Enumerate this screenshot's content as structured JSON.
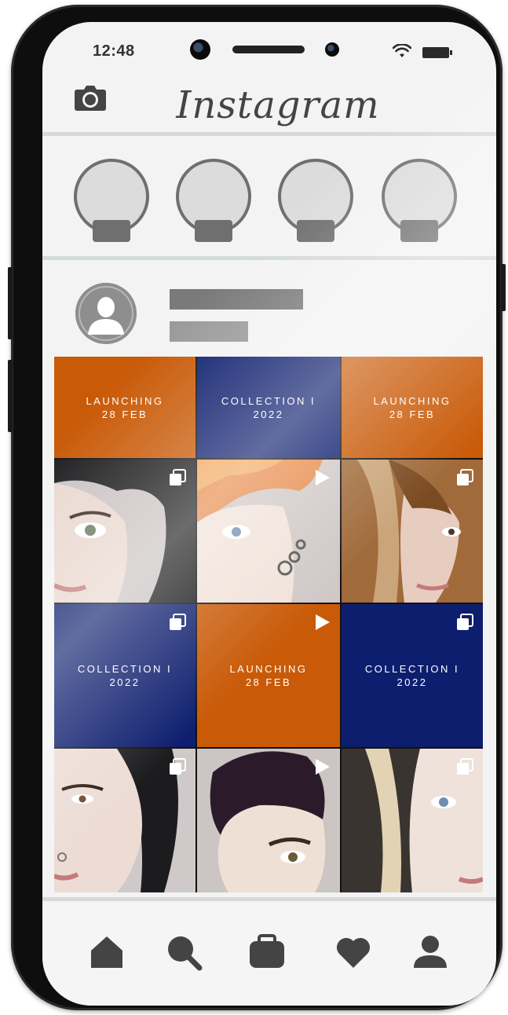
{
  "status_bar": {
    "time": "12:48"
  },
  "header": {
    "logo_text": "Instagram",
    "camera_icon": "camera-icon"
  },
  "stories": [
    {
      "icon": "story-avatar"
    },
    {
      "icon": "story-avatar"
    },
    {
      "icon": "story-avatar"
    },
    {
      "icon": "story-avatar"
    }
  ],
  "profile": {
    "avatar_icon": "user-silhouette-icon"
  },
  "grid": {
    "rows": [
      [
        {
          "kind": "text",
          "color": "#c95a08",
          "line1": "LAUNCHING",
          "line2": "28 FEB"
        },
        {
          "kind": "text",
          "color": "#0e1e6e",
          "line1": "COLLECTION I",
          "line2": "2022"
        },
        {
          "kind": "text",
          "color": "#c95a08",
          "line1": "LAUNCHING",
          "line2": "28 FEB"
        }
      ],
      [
        {
          "kind": "photo",
          "overlay": "carousel-icon"
        },
        {
          "kind": "photo",
          "overlay": "play-icon"
        },
        {
          "kind": "photo",
          "overlay": "carousel-icon"
        }
      ],
      [
        {
          "kind": "text",
          "color": "#0e1e6e",
          "line1": "COLLECTION I",
          "line2": "2022",
          "overlay": "carousel-icon"
        },
        {
          "kind": "text",
          "color": "#c95a08",
          "line1": "LAUNCHING",
          "line2": "28 FEB",
          "overlay": "play-icon"
        },
        {
          "kind": "text",
          "color": "#0e1e6e",
          "line1": "COLLECTION I",
          "line2": "2022",
          "overlay": "carousel-icon"
        }
      ],
      [
        {
          "kind": "photo",
          "overlay": "carousel-icon"
        },
        {
          "kind": "photo",
          "overlay": "play-icon"
        },
        {
          "kind": "photo",
          "overlay": "carousel-icon"
        }
      ]
    ]
  },
  "bottom_nav": [
    "home-icon",
    "search-icon",
    "shop-icon",
    "heart-icon",
    "profile-icon"
  ],
  "colors": {
    "accent_orange": "#c95a08",
    "accent_navy": "#0e1e6e",
    "ui_gray": "#6f6f6f"
  }
}
